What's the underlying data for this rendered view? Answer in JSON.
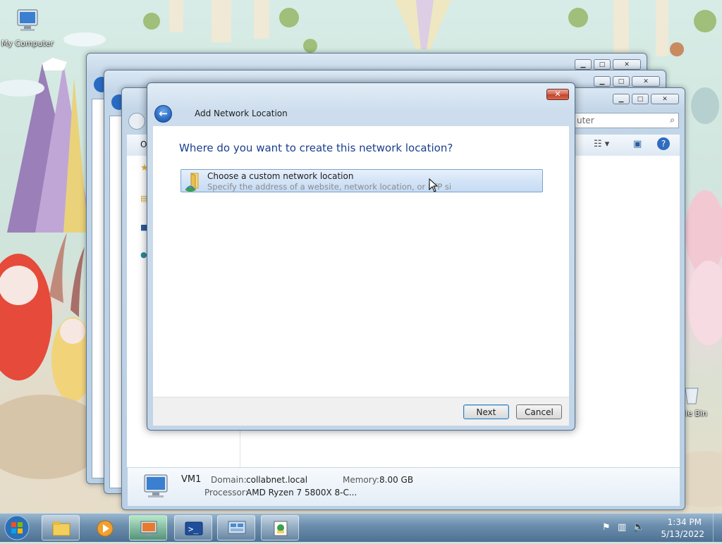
{
  "desktop": {
    "icons": [
      {
        "label": "My Computer"
      },
      {
        "label": "cle Bin"
      }
    ]
  },
  "back_window": {
    "search_placeholder": "uter",
    "sidebar_partial": "O"
  },
  "dialog": {
    "title": "Add Network Location",
    "heading": "Where do you want to create this network location?",
    "option": {
      "title": "Choose a custom network location",
      "description": "Specify the address of a website, network location, or FTP si"
    },
    "next_label": "Next",
    "cancel_label": "Cancel",
    "close_glyph": "✕"
  },
  "details": {
    "name": "VM1",
    "domain_key": "Domain:",
    "domain_value": "collabnet.local",
    "memory_key": "Memory:",
    "memory_value": "8.00 GB",
    "processor_key": "Processor:",
    "processor_value": "AMD Ryzen 7 5800X 8-C..."
  },
  "taskbar": {
    "items": [
      "start",
      "explorer",
      "media-player",
      "computer-management",
      "powershell",
      "remote-desktop",
      "network-explorer"
    ],
    "time": "1:34 PM",
    "date": "5/13/2022"
  },
  "colors": {
    "heading": "#1a3f8e",
    "option_bg": "#d4e4f7",
    "close_button": "#c2432e"
  }
}
